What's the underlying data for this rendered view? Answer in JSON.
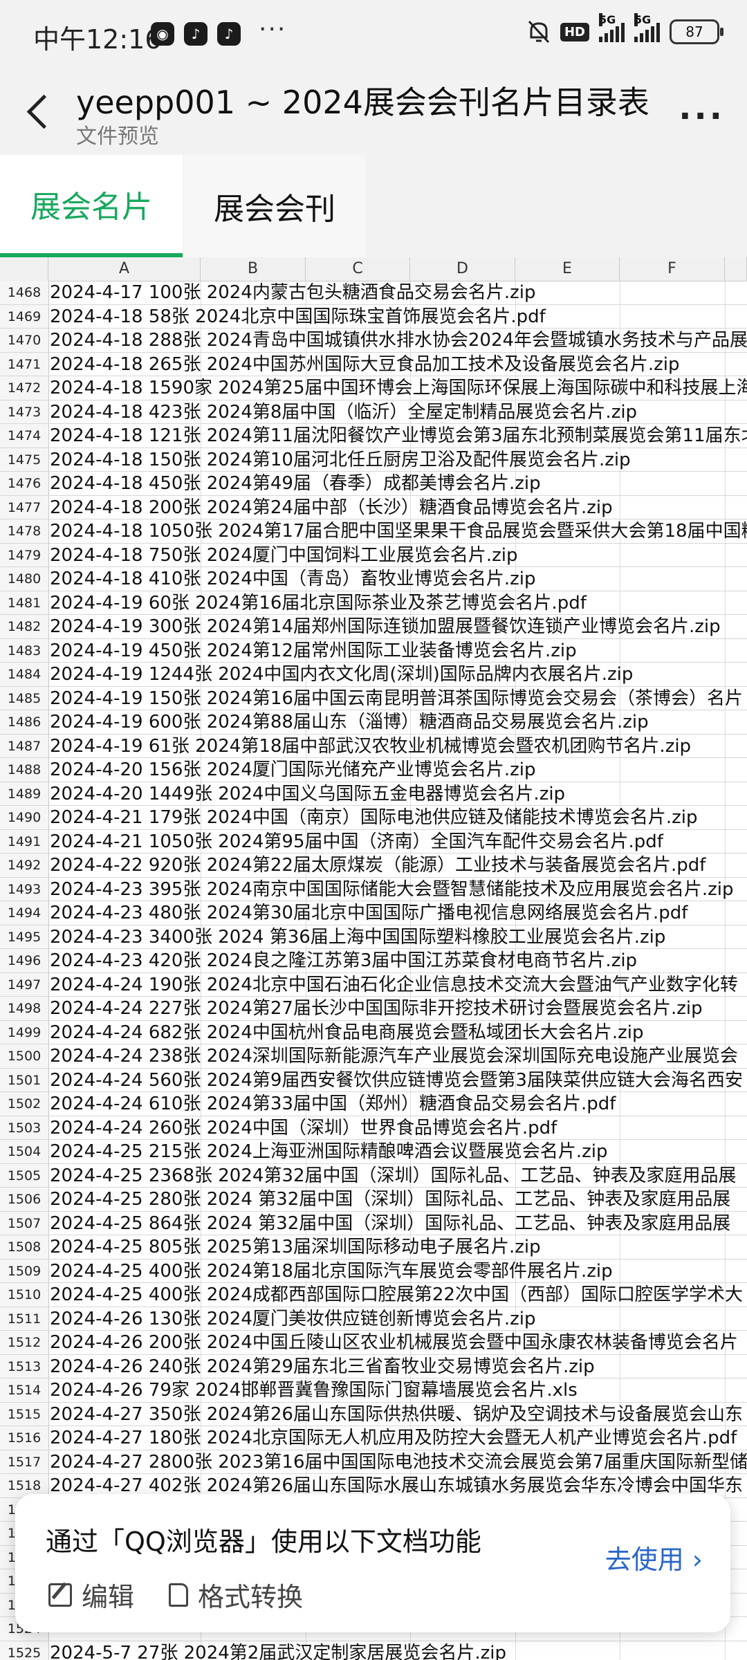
{
  "status": {
    "time": "中午12:16",
    "dots": "···",
    "hd": "HD",
    "net1": "5G",
    "net2": "5G",
    "battery": "87"
  },
  "header": {
    "title": "yeepp001 ~ 2024展会会刊名片目录表...",
    "subtitle": "文件预览",
    "more": "···"
  },
  "tabs": [
    {
      "label": "展会名片",
      "active": true
    },
    {
      "label": "展会会刊",
      "active": false
    }
  ],
  "columns": [
    "A",
    "B",
    "C",
    "D",
    "E",
    "F"
  ],
  "rows": [
    {
      "n": "1468",
      "text": "2024-4-17 100张 2024内蒙古包头糖酒食品交易会名片.zip"
    },
    {
      "n": "1469",
      "text": "2024-4-18 58张 2024北京中国国际珠宝首饰展览会名片.pdf"
    },
    {
      "n": "1470",
      "text": "2024-4-18 288张 2024青岛中国城镇供水排水协会2024年会暨城镇水务技术与产品展"
    },
    {
      "n": "1471",
      "text": "2024-4-18 265张 2024中国苏州国际大豆食品加工技术及设备展览会名片.zip"
    },
    {
      "n": "1472",
      "text": "2024-4-18 1590家 2024第25届中国环博会上海国际环保展上海国际碳中和科技展上海"
    },
    {
      "n": "1473",
      "text": "2024-4-18 423张 2024第8届中国（临沂）全屋定制精品展览会名片.zip"
    },
    {
      "n": "1474",
      "text": "2024-4-18 121张 2024第11届沈阳餐饮产业博览会第3届东北预制菜展览会第11届东北"
    },
    {
      "n": "1475",
      "text": "2024-4-18 150张 2024第10届河北任丘厨房卫浴及配件展览会名片.zip"
    },
    {
      "n": "1476",
      "text": "2024-4-18 450张 2024第49届（春季）成都美博会名片.zip"
    },
    {
      "n": "1477",
      "text": "2024-4-18 200张 2024第24届中部（长沙）糖酒食品博览会名片.zip"
    },
    {
      "n": "1478",
      "text": "2024-4-18 1050张 2024第17届合肥中国坚果果干食品展览会暨采供大会第18届中国糖"
    },
    {
      "n": "1479",
      "text": "2024-4-18 750张 2024厦门中国饲料工业展览会名片.zip"
    },
    {
      "n": "1480",
      "text": "2024-4-18 410张 2024中国（青岛）畜牧业博览会名片.zip"
    },
    {
      "n": "1481",
      "text": "2024-4-19 60张 2024第16届北京国际茶业及茶艺博览会名片.pdf"
    },
    {
      "n": "1482",
      "text": "2024-4-19 300张 2024第14届郑州国际连锁加盟展暨餐饮连锁产业博览会名片.zip"
    },
    {
      "n": "1483",
      "text": "2024-4-19 450张 2024第12届常州国际工业装备博览会名片.zip"
    },
    {
      "n": "1484",
      "text": "2024-4-19 1244张 2024中国内衣文化周(深圳)国际品牌内衣展名片.zip"
    },
    {
      "n": "1485",
      "text": "2024-4-19 150张 2024第16届中国云南昆明普洱茶国际博览会交易会（茶博会）名片"
    },
    {
      "n": "1486",
      "text": "2024-4-19 600张 2024第88届山东（淄博）糖酒商品交易展览会名片.zip"
    },
    {
      "n": "1487",
      "text": "2024-4-19 61张 2024第18届中部武汉农牧业机械博览会暨农机团购节名片.zip"
    },
    {
      "n": "1488",
      "text": "2024-4-20 156张 2024厦门国际光储充产业博览会名片.zip"
    },
    {
      "n": "1489",
      "text": "2024-4-20 1449张 2024中国义乌国际五金电器博览会名片.zip"
    },
    {
      "n": "1490",
      "text": "2024-4-21 179张 2024中国（南京）国际电池供应链及储能技术博览会名片.zip"
    },
    {
      "n": "1491",
      "text": "2024-4-21 1050张 2024第95届中国（济南）全国汽车配件交易会名片.pdf"
    },
    {
      "n": "1492",
      "text": "2024-4-22 920张 2024第22届太原煤炭（能源）工业技术与装备展览会名片.pdf"
    },
    {
      "n": "1493",
      "text": "2024-4-23 395张 2024南京中国国际储能大会暨智慧储能技术及应用展览会名片.zip"
    },
    {
      "n": "1494",
      "text": "2024-4-23 480张 2024第30届北京中国国际广播电视信息网络展览会名片.pdf"
    },
    {
      "n": "1495",
      "text": "2024-4-23 3400张 2024 第36届上海中国国际塑料橡胶工业展览会名片.zip"
    },
    {
      "n": "1496",
      "text": "2024-4-23 420张 2024良之隆江苏第3届中国江苏菜食材电商节名片.zip"
    },
    {
      "n": "1497",
      "text": "2024-4-24 190张 2024北京中国石油石化企业信息技术交流大会暨油气产业数字化转"
    },
    {
      "n": "1498",
      "text": "2024-4-24 227张 2024第27届长沙中国国际非开挖技术研讨会暨展览会名片.zip"
    },
    {
      "n": "1499",
      "text": "2024-4-24 682张 2024中国杭州食品电商展览会暨私域团长大会名片.zip"
    },
    {
      "n": "1500",
      "text": "2024-4-24 238张 2024深圳国际新能源汽车产业展览会深圳国际充电设施产业展览会"
    },
    {
      "n": "1501",
      "text": "2024-4-24 560张 2024第9届西安餐饮供应链博览会暨第3届陕菜供应链大会海名西安"
    },
    {
      "n": "1502",
      "text": "2024-4-24 610张 2024第33届中国（郑州）糖酒食品交易会名片.pdf"
    },
    {
      "n": "1503",
      "text": "2024-4-24 260张 2024中国（深圳）世界食品博览会名片.pdf"
    },
    {
      "n": "1504",
      "text": "2024-4-25 215张 2024上海亚洲国际精酿啤酒会议暨展览会名片.zip"
    },
    {
      "n": "1505",
      "text": "2024-4-25 2368张 2024第32届中国（深圳）国际礼品、工艺品、钟表及家庭用品展"
    },
    {
      "n": "1506",
      "text": "2024-4-25 280张 2024 第32届中国（深圳）国际礼品、工艺品、钟表及家庭用品展"
    },
    {
      "n": "1507",
      "text": "2024-4-25 864张 2024 第32届中国（深圳）国际礼品、工艺品、钟表及家庭用品展"
    },
    {
      "n": "1508",
      "text": "2024-4-25 805张 2025第13届深圳国际移动电子展名片.zip"
    },
    {
      "n": "1509",
      "text": "2024-4-25 400张 2024第18届北京国际汽车展览会零部件展名片.zip"
    },
    {
      "n": "1510",
      "text": "2024-4-25 400张 2024成都西部国际口腔展第22次中国（西部）国际口腔医学学术大"
    },
    {
      "n": "1511",
      "text": "2024-4-26 130张 2024厦门美妆供应链创新博览会名片.zip"
    },
    {
      "n": "1512",
      "text": "2024-4-26 200张 2024中国丘陵山区农业机械展览会暨中国永康农林装备博览会名片"
    },
    {
      "n": "1513",
      "text": "2024-4-26 240张 2024第29届东北三省畜牧业交易博览会名片.zip"
    },
    {
      "n": "1514",
      "text": "2024-4-26 79家 2024邯郸晋冀鲁豫国际门窗幕墙展览会名片.xls"
    },
    {
      "n": "1515",
      "text": "2024-4-27 350张 2024第26届山东国际供热供暖、锅炉及空调技术与设备展览会山东"
    },
    {
      "n": "1516",
      "text": "2024-4-27 180张 2024北京国际无人机应用及防控大会暨无人机产业博览会名片.pdf"
    },
    {
      "n": "1517",
      "text": "2024-4-27 2800张 2023第16届中国国际电池技术交流会展览会第7届重庆国际新型储"
    },
    {
      "n": "1518",
      "text": "2024-4-27 402张 2024第26届山东国际水展山东城镇水务展览会华东冷博会中国华东"
    },
    {
      "n": "1519",
      "text": ""
    },
    {
      "n": "1520",
      "text": ""
    },
    {
      "n": "1521",
      "text": ""
    },
    {
      "n": "1522",
      "text": ""
    },
    {
      "n": "1523",
      "text": ""
    },
    {
      "n": "1524",
      "text": ""
    },
    {
      "n": "1525",
      "text": "2024-5-7 27张 2024第2届武汉定制家居展览会名片.zip"
    }
  ],
  "popup": {
    "message": "通过「QQ浏览器」使用以下文档功能",
    "edit": "编辑",
    "convert": "格式转换",
    "go": "去使用 ›"
  }
}
